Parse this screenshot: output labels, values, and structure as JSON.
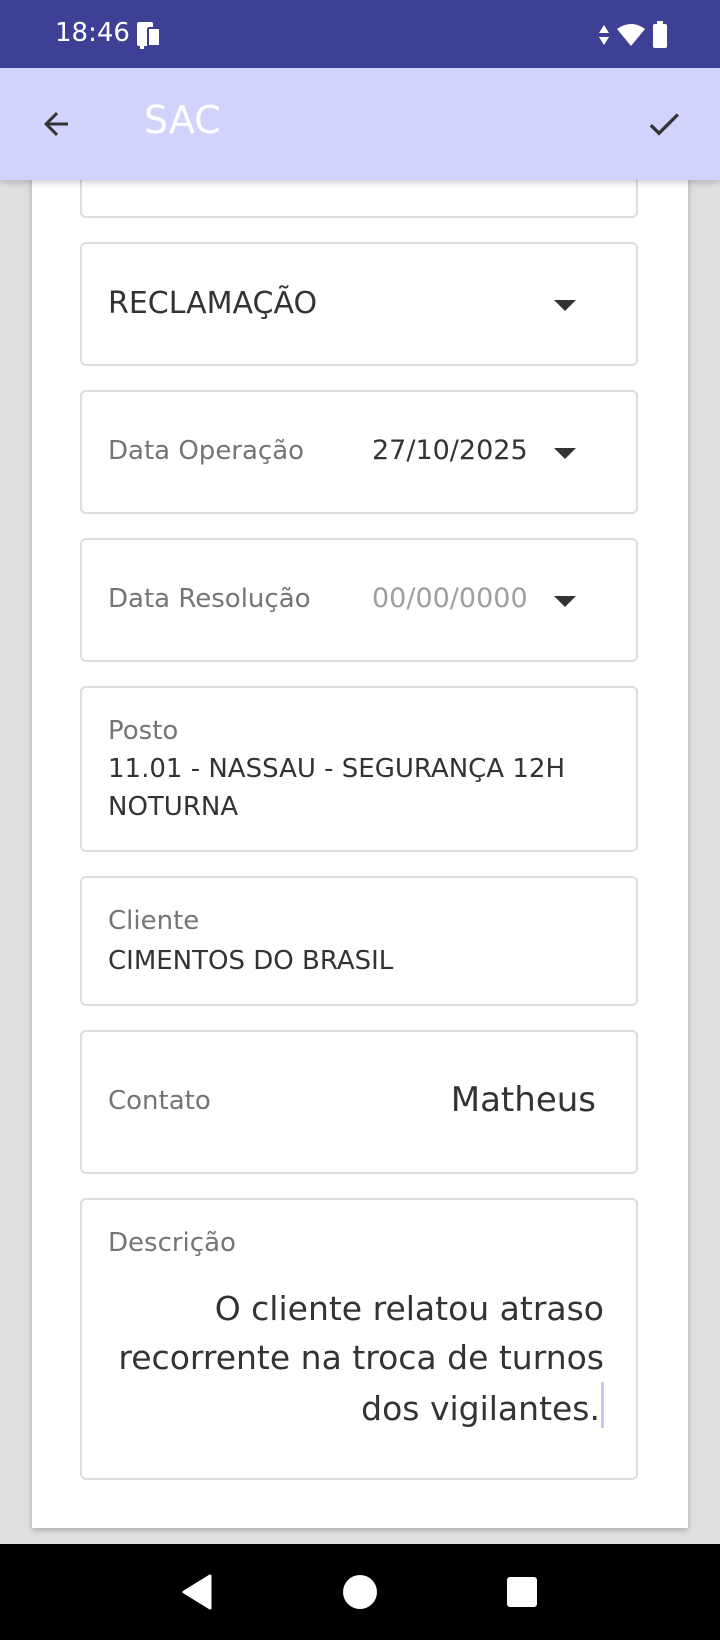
{
  "status_bar": {
    "time": "18:46"
  },
  "app_bar": {
    "title": "SAC"
  },
  "form": {
    "type_value": "RECLAMAÇÃO",
    "data_operacao": {
      "label": "Data Operação",
      "value": "27/10/2025"
    },
    "data_resolucao": {
      "label": "Data Resolução",
      "placeholder": "00/00/0000"
    },
    "posto": {
      "label": "Posto",
      "value_line1": "11.01 - NASSAU - SEGURANÇA 12H",
      "value_line2": "NOTURNA"
    },
    "cliente": {
      "label": "Cliente",
      "value": "CIMENTOS DO BRASIL"
    },
    "contato": {
      "label": "Contato",
      "value": "Matheus"
    },
    "descricao": {
      "label": "Descrição",
      "line1": "O cliente relatou atraso",
      "line2": "recorrente na troca de turnos",
      "line3": "dos vigilantes."
    }
  },
  "colors": {
    "status_bar": "#3e4095",
    "app_bar": "#d1d3fd",
    "background": "#e0e0e0",
    "card": "#ffffff"
  },
  "icons": {
    "back": "arrow-left",
    "confirm": "checkmark",
    "dropdown": "caret-down",
    "nav_back": "triangle",
    "nav_home": "circle",
    "nav_recents": "square"
  }
}
